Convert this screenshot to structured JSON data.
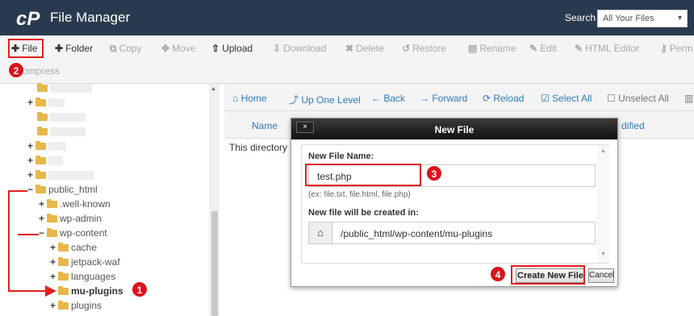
{
  "header": {
    "title": "File Manager",
    "search_label": "Search",
    "search_scope": "All Your Files",
    "bg_color": "#2a3a4e"
  },
  "toolbar": {
    "file": "File",
    "folder": "Folder",
    "copy": "Copy",
    "move": "Move",
    "upload": "Upload",
    "download": "Download",
    "delete": "Delete",
    "restore": "Restore",
    "rename": "Rename",
    "edit": "Edit",
    "html_editor": "HTML Editor",
    "permissions": "Perm",
    "compress": "ompress"
  },
  "tree": {
    "public_html": "public_html",
    "well_known": ".well-known",
    "wp_admin": "wp-admin",
    "wp_content": "wp-content",
    "cache": "cache",
    "jetpack": "jetpack-waf",
    "languages": "languages",
    "mu_plugins": "mu-plugins",
    "plugins": "plugins"
  },
  "nav": {
    "home": "Home",
    "up": "Up One Level",
    "back": "Back",
    "forward": "Forward",
    "reload": "Reload",
    "select_all": "Select All",
    "unselect_all": "Unselect All"
  },
  "list": {
    "col_name": "Name",
    "col_modified": "dified",
    "empty": "This directory i"
  },
  "modal": {
    "title": "New File",
    "close": "×",
    "file_name_label": "New File Name:",
    "file_name_value": "test.php",
    "file_name_hint": "(ex: file.txt, file.html, file.php)",
    "dest_label": "New file will be created in:",
    "dest_value": "/public_html/wp-content/mu-plugins",
    "create_button": "Create New File",
    "cancel_button": "Cancel"
  },
  "steps": {
    "s1": "1",
    "s2": "2",
    "s3": "3",
    "s4": "4"
  },
  "colors": {
    "highlight_red": "#e02020",
    "badge_red": "#d9141c",
    "link_blue": "#337ab7",
    "folder_yellow": "#e6b84a"
  }
}
